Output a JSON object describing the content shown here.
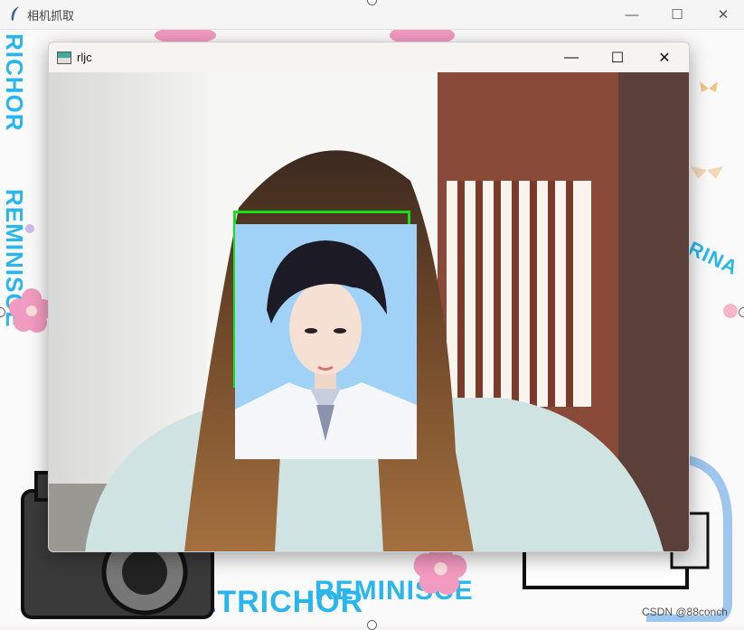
{
  "outer_window": {
    "title": "相机抓取",
    "minimize_symbol": "—",
    "maximize_symbol": "☐",
    "close_symbol": "✕"
  },
  "inner_window": {
    "title": "rljc",
    "minimize_symbol": "—",
    "maximize_symbol": "☐",
    "close_symbol": "✕"
  },
  "wallpaper_text": {
    "left_vertical_1": "RICHOR",
    "left_vertical_2": "REMINISCE",
    "right_text": "RINA",
    "bottom_1": "PETRICHOR",
    "bottom_2": "REMINISCE"
  },
  "watermark": "CSDN @88conch",
  "colors": {
    "face_box": "#18e018",
    "id_photo_background": "#9fd2f6",
    "wallpaper_text": "#29b6ef"
  }
}
